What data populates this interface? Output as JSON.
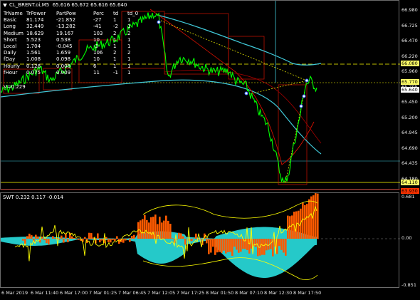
{
  "main": {
    "symbol": "CL_BRENT.oi,M5",
    "ohlc": "65.616 65.672 65.616 65.640",
    "table": {
      "headers": [
        "TrName",
        "TrPower",
        "PartPow",
        "Perc",
        "td",
        "td_0"
      ],
      "rows": [
        [
          "Basic",
          "81.174",
          "-21.852",
          "-27",
          "1",
          "1"
        ],
        [
          "Long",
          "32.449",
          "-13.282",
          "-41",
          "-2",
          "1"
        ],
        [
          "Medium",
          "18.629",
          "19.167",
          "103",
          "2",
          "2"
        ],
        [
          "Short",
          "5.523",
          "0.538",
          "10",
          "1",
          "1"
        ],
        [
          "Local",
          "1.704",
          "-0.045",
          "-3",
          "1",
          "1"
        ],
        [
          "Daily",
          "1.561",
          "1.659",
          "106",
          "2",
          "2"
        ],
        [
          "fDay",
          "1.008",
          "0.098",
          "10",
          "1",
          "1"
        ],
        [
          "Hourly",
          "0.128",
          "0.008",
          "6",
          "1",
          "1"
        ],
        [
          "fHour",
          "0.075",
          "0.009",
          "11",
          "-1",
          "1"
        ]
      ]
    },
    "v_text": "V=0.229",
    "price_ticks": [
      "66.980",
      "66.725",
      "66.470",
      "66.220",
      "65.960",
      "65.705",
      "65.450",
      "65.200",
      "64.945",
      "64.690",
      "64.435",
      "64.180"
    ],
    "price_labels": [
      {
        "text": "66.080",
        "bg": "#ffff66"
      },
      {
        "text": "65.770",
        "bg": "#ffff66"
      },
      {
        "text": "65.640",
        "bg": "#ffffff"
      },
      {
        "text": "64.110",
        "bg": "#ffff66"
      },
      {
        "text": "63.930",
        "bg": "#ff3300"
      }
    ]
  },
  "oscillator": {
    "title": "SWT 0.232 0.117 -0.014",
    "ticks": [
      "0.681",
      "0.00",
      "-0.851"
    ]
  },
  "time_axis": [
    "6 Mar 2019",
    "6 Mar 11:40",
    "6 Mar 17:00",
    "7 Mar 01:25",
    "7 Mar 06:45",
    "7 Mar 12:05",
    "7 Mar 17:25",
    "8 Mar 01:50",
    "8 Mar 07:10",
    "8 Mar 12:30",
    "8 Mar 17:50"
  ],
  "colors": {
    "price": "#00ff00",
    "ma_cyan": "#40c8d8",
    "red_line": "#d01000",
    "yellow": "#ffff00",
    "orange_fill": "#ff5a00",
    "cyan_fill": "#27d4d4"
  }
}
